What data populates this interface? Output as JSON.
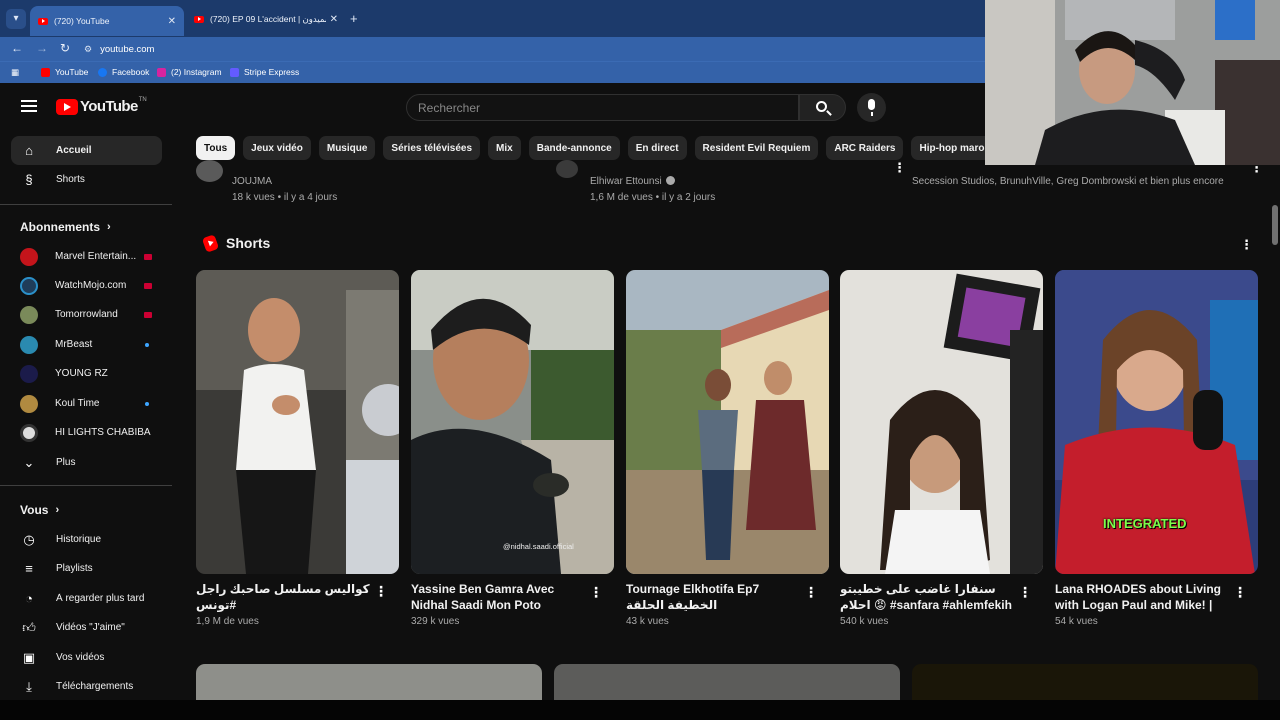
{
  "browser": {
    "tabs": [
      {
        "title": "(720) YouTube",
        "active": true
      },
      {
        "title": "(720) EP 09 L'accident | شميدون",
        "active": false
      }
    ],
    "url": "youtube.com",
    "bookmarks": [
      "YouTube",
      "Facebook",
      "(2) Instagram",
      "Stripe Express"
    ]
  },
  "header": {
    "logo_text": "YouTube",
    "logo_superscript": "TN",
    "search_placeholder": "Rechercher"
  },
  "chips": [
    "Tous",
    "Jeux vidéo",
    "Musique",
    "Séries télévisées",
    "Mix",
    "Bande-annonce",
    "En direct",
    "Resident Evil Requiem",
    "ARC Raiders",
    "Hip-hop maro"
  ],
  "sidebar": {
    "main": [
      {
        "label": "Accueil",
        "icon": "home-icon"
      },
      {
        "label": "Shorts",
        "icon": "shorts-icon"
      }
    ],
    "subscriptions_heading": "Abonnements",
    "subscriptions": [
      {
        "label": "Marvel Entertain...",
        "indicator": "live",
        "color": "#c4141b"
      },
      {
        "label": "WatchMojo.com",
        "indicator": "live",
        "color": "#1f3d5a"
      },
      {
        "label": "Tomorrowland",
        "indicator": "live",
        "color": "#7a8a5a"
      },
      {
        "label": "MrBeast",
        "indicator": "dot",
        "color": "#2a8ab0"
      },
      {
        "label": "YOUNG RZ",
        "indicator": "none",
        "color": "#1b1b4a"
      },
      {
        "label": "Koul Time",
        "indicator": "dot",
        "color": "#b08a40"
      },
      {
        "label": "HI LIGHTS CHABIBA",
        "indicator": "none",
        "color": "#dddddd"
      }
    ],
    "more_label": "Plus",
    "you_heading": "Vous",
    "you_items": [
      {
        "label": "Historique",
        "icon": "history-icon"
      },
      {
        "label": "Playlists",
        "icon": "playlists-icon"
      },
      {
        "label": "À regarder plus tard",
        "icon": "watch-later-icon"
      },
      {
        "label": "Vidéos \"J'aime\"",
        "icon": "like-icon"
      },
      {
        "label": "Vos vidéos",
        "icon": "your-videos-icon"
      },
      {
        "label": "Téléchargements",
        "icon": "downloads-icon"
      }
    ]
  },
  "top_row": [
    {
      "channel": "JOUJMA",
      "meta": "18 k vues • il y a 4 jours"
    },
    {
      "channel": "Elhiwar Ettounsi",
      "meta": "1,6 M de vues • il y a 2 jours"
    },
    {
      "channel": "Secession Studios, BrunuhVille, Greg Dombrowski et bien plus encore",
      "meta": ""
    }
  ],
  "shorts": {
    "heading": "Shorts",
    "items": [
      {
        "title": "كواليس مسلسل صاحبك راجل #تونس",
        "views": "1,9 M de vues"
      },
      {
        "title": "Yassine Ben Gamra Avec Nidhal Saadi Mon Poto",
        "views": "329 k vues"
      },
      {
        "title": "Tournage Elkhotifa Ep7 الخطيفة الحلقة",
        "views": "43 k vues"
      },
      {
        "title": "سنفارا غاضب على خطيبتو احلام 😡 #sanfara #ahlemfekih",
        "views": "540 k vues"
      },
      {
        "title": "Lana RHOADES about Living with Logan Paul and Mike! | Any ...",
        "views": "54 k vues"
      }
    ],
    "overlay_text": "INTEGRATED",
    "watermark": "@nidhal.saadi.official"
  }
}
